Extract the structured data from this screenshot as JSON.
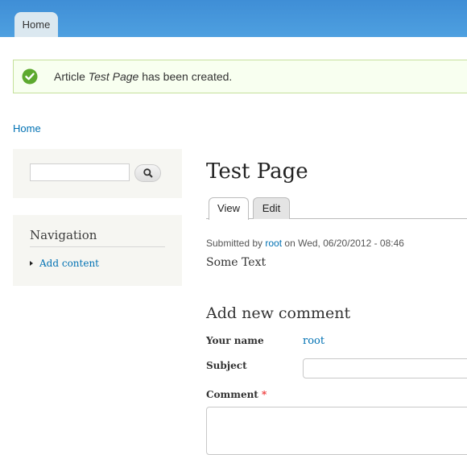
{
  "top_tabs": {
    "home": "Home"
  },
  "status_message": {
    "prefix": "Article ",
    "title": "Test Page",
    "suffix": " has been created."
  },
  "breadcrumb": {
    "home": "Home"
  },
  "search": {
    "value": ""
  },
  "navigation": {
    "title": "Navigation",
    "items": [
      {
        "label": "Add content"
      }
    ]
  },
  "node": {
    "title": "Test Page",
    "tabs": [
      {
        "label": "View"
      },
      {
        "label": "Edit"
      }
    ],
    "submitted_prefix": "Submitted by ",
    "author": "root",
    "submitted_suffix": " on Wed, 06/20/2012 - 08:46",
    "body": "Some Text"
  },
  "comment_form": {
    "heading": "Add new comment",
    "name_label": "Your name",
    "name_value": "root",
    "subject_label": "Subject",
    "comment_label": "Comment",
    "required_marker": "*"
  },
  "colors": {
    "accent": "#0071b3",
    "header": "#4ea0e0",
    "success_bg": "#f8fff0"
  }
}
